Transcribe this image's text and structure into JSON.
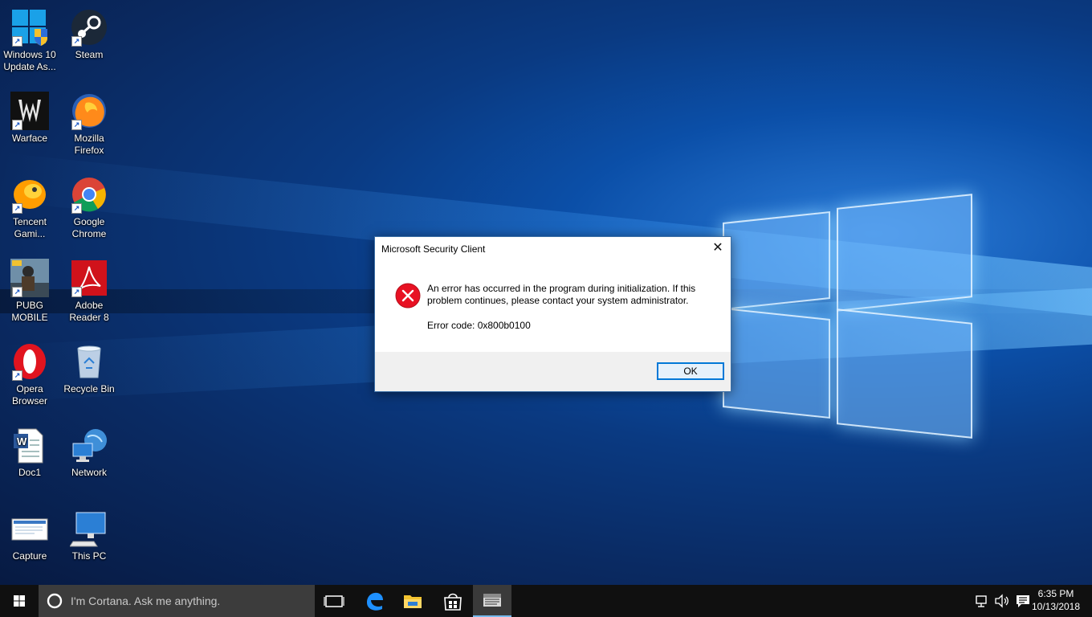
{
  "desktop": {
    "icons": [
      {
        "label": "Windows 10 Update As...",
        "icon": "windows-update-icon"
      },
      {
        "label": "Steam",
        "icon": "steam-icon"
      },
      {
        "label": "Warface",
        "icon": "warface-icon"
      },
      {
        "label": "Mozilla Firefox",
        "icon": "firefox-icon"
      },
      {
        "label": "Tencent Gami...",
        "icon": "tencent-gaming-icon"
      },
      {
        "label": "Google Chrome",
        "icon": "chrome-icon"
      },
      {
        "label": "PUBG MOBILE",
        "icon": "pubg-icon"
      },
      {
        "label": "Adobe Reader 8",
        "icon": "adobe-reader-icon"
      },
      {
        "label": "Opera Browser",
        "icon": "opera-icon"
      },
      {
        "label": "Recycle Bin",
        "icon": "recycle-bin-icon"
      },
      {
        "label": "Doc1",
        "icon": "word-document-icon"
      },
      {
        "label": "Network",
        "icon": "network-icon"
      },
      {
        "label": "Capture",
        "icon": "image-file-icon"
      },
      {
        "label": "This PC",
        "icon": "this-pc-icon"
      }
    ]
  },
  "dialog": {
    "title": "Microsoft Security Client",
    "message": "An error has occurred in the program during initialization. If this problem continues, please contact your system administrator.",
    "error_code": "Error code: 0x800b0100",
    "ok_label": "OK",
    "close_icon": "close-icon",
    "status_icon": "error-icon"
  },
  "taskbar": {
    "search_placeholder": "I'm Cortana. Ask me anything.",
    "pinned": [
      "task-view-icon",
      "edge-icon",
      "file-explorer-icon",
      "store-icon",
      "security-client-icon"
    ],
    "tray_icons": [
      "network-icon",
      "volume-icon",
      "action-center-icon"
    ],
    "time": "6:35 PM",
    "date": "10/13/2018"
  },
  "colors": {
    "accent": "#0078d7",
    "error": "#e81123",
    "taskbar": "#101010"
  }
}
